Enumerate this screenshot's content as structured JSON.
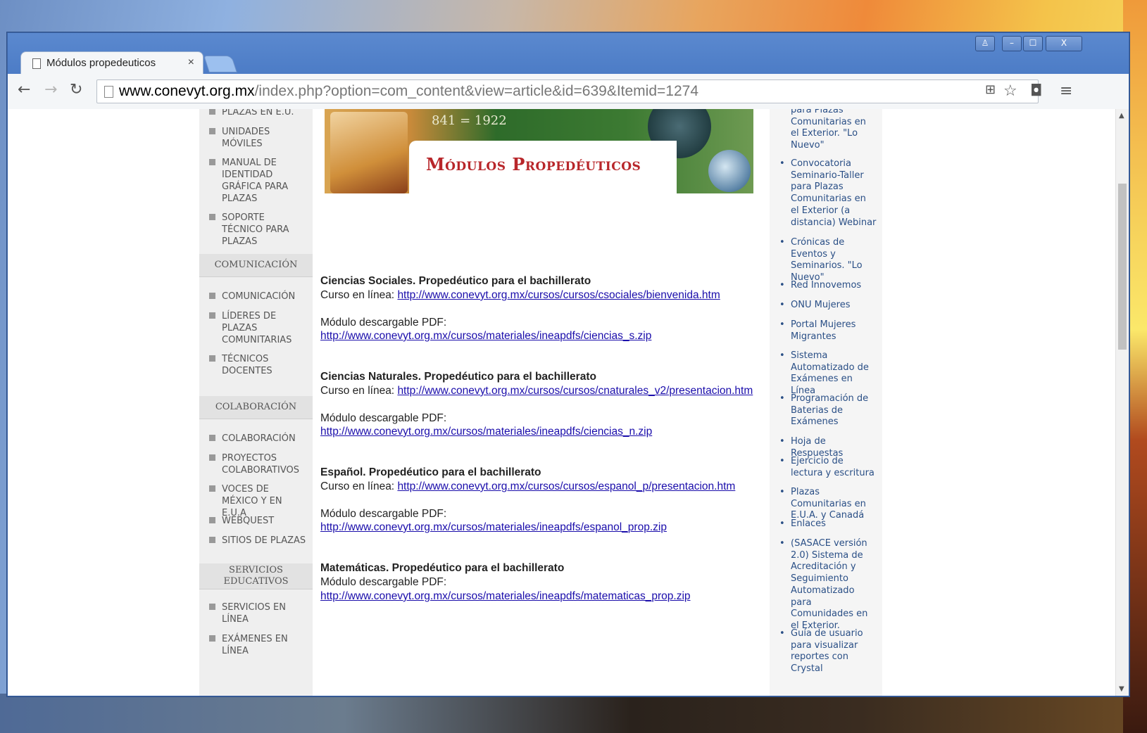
{
  "browser": {
    "tab_title": "Módulos propedeuticos",
    "tab_close": "×",
    "url_domain": "www.conevyt.org.mx",
    "url_path": "/index.php?option=com_content&view=article&id=639&Itemid=1274",
    "window_controls": [
      "♙",
      "–",
      "☐",
      "X"
    ]
  },
  "left_nav": {
    "items_top": [
      "PLAZAS EN E.U.",
      "UNIDADES MÓVILES",
      "MANUAL DE IDENTIDAD GRÁFICA PARA PLAZAS",
      "SOPORTE TÉCNICO PARA PLAZAS"
    ],
    "head_comunicacion": "COMUNICACIÓN",
    "items_comunicacion": [
      "COMUNICACIÓN",
      "LÍDERES DE PLAZAS COMUNITARIAS",
      "TÉCNICOS DOCENTES"
    ],
    "head_colaboracion": "COLABORACIÓN",
    "items_colaboracion": [
      "COLABORACIÓN",
      "PROYECTOS COLABORATIVOS",
      "VOCES DE MÉXICO Y EN E.U.A",
      "WEBQUEST",
      "SITIOS DE PLAZAS"
    ],
    "head_servicios": "SERVICIOS EDUCATIVOS",
    "items_servicios": [
      "SERVICIOS EN LÍNEA",
      "EXÁMENES EN LÍNEA"
    ]
  },
  "banner": {
    "title": "Módulos Propedéuticos",
    "numbers": "841 = 1922"
  },
  "article": {
    "sociales_heading": "Ciencias Sociales. Propedéutico para el bachillerato",
    "online_label": "Curso en línea:",
    "sociales_url": "http://www.conevyt.org.mx/cursos/cursos/csociales/bienvenida.htm",
    "pdf_label": "Módulo descargable PDF:",
    "sociales_pdf": "http://www.conevyt.org.mx/cursos/materiales/ineapdfs/ciencias_s.zip",
    "naturales_heading": "Ciencias Naturales. Propedéutico para el bachillerato",
    "naturales_url": "http://www.conevyt.org.mx/cursos/cursos/cnaturales_v2/presentacion.htm",
    "naturales_pdf": "http://www.conevyt.org.mx/cursos/materiales/ineapdfs/ciencias_n.zip",
    "espanol_heading": "Español. Propedéutico para el bachillerato",
    "espanol_url": "http://www.conevyt.org.mx/cursos/cursos/espanol_p/presentacion.htm",
    "espanol_pdf": "http://www.conevyt.org.mx/cursos/materiales/ineapdfs/espanol_prop.zip",
    "mate_heading": "Matemáticas. Propedéutico para el bachillerato",
    "mate_pdf": "http://www.conevyt.org.mx/cursos/materiales/ineapdfs/matematicas_prop.zip"
  },
  "right_links": [
    "para Plazas Comunitarias en el Exterior. \"Lo Nuevo\"",
    "Convocatoria Seminario-Taller para Plazas Comunitarias en el Exterior (a distancia) Webinar",
    "Crónicas de Eventos y Seminarios. \"Lo Nuevo\"",
    "Red Innovemos",
    "ONU Mujeres",
    "Portal Mujeres Migrantes",
    "Sistema Automatizado de Exámenes en Línea",
    "Programación de Baterias de Exámenes",
    "Hoja de Respuestas",
    "Ejercicio de lectura y escritura",
    "Plazas Comunitarias en E.U.A. y Canadá",
    "Enlaces",
    "(SASACE versión 2.0) Sistema de Acreditación y Seguimiento Automatizado para Comunidades en el Exterior.",
    "Guía de usuario para visualizar reportes con Crystal"
  ],
  "colors": {
    "link": "#1a0dab",
    "right_link": "#2a4f86",
    "banner_title": "#b8262a"
  }
}
